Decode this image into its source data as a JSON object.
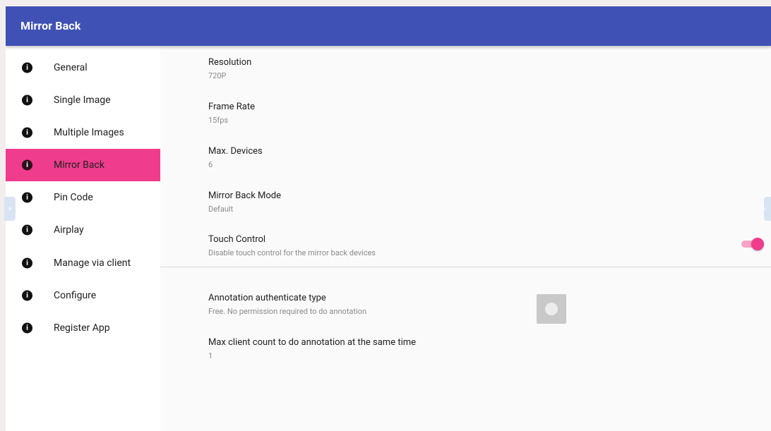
{
  "app_title": "Mirror Back",
  "sidebar": {
    "items": [
      {
        "label": "General",
        "icon": "info-icon",
        "active": false
      },
      {
        "label": "Single Image",
        "icon": "info-icon",
        "active": false
      },
      {
        "label": "Multiple Images",
        "icon": "info-icon",
        "active": false
      },
      {
        "label": "Mirror Back",
        "icon": "info-icon",
        "active": true
      },
      {
        "label": "Pin Code",
        "icon": "info-icon",
        "active": false
      },
      {
        "label": "Airplay",
        "icon": "info-icon",
        "active": false
      },
      {
        "label": "Manage via client",
        "icon": "info-icon",
        "active": false
      },
      {
        "label": "Configure",
        "icon": "info-icon",
        "active": false
      },
      {
        "label": "Register App",
        "icon": "info-icon",
        "active": false
      }
    ]
  },
  "settings": {
    "resolution": {
      "title": "Resolution",
      "value": "720P"
    },
    "frame_rate": {
      "title": "Frame Rate",
      "value": "15fps"
    },
    "max_devices": {
      "title": "Max. Devices",
      "value": "6"
    },
    "mirror_back_mode": {
      "title": "Mirror Back Mode",
      "value": "Default"
    },
    "touch_control": {
      "title": "Touch Control",
      "summary": "Disable touch control for the mirror back devices",
      "enabled": true
    },
    "annotation_auth": {
      "title": "Annotation authenticate type",
      "summary": "Free. No permission required to do annotation"
    },
    "max_client_count": {
      "title": "Max client count to do annotation at the same time",
      "value": "1"
    }
  },
  "colors": {
    "appbar": "#3f51b5",
    "accent": "#f03c8d",
    "background": "#fafafa"
  },
  "edge_tabs": {
    "left_glyph": "»",
    "right_glyph": "‹"
  }
}
